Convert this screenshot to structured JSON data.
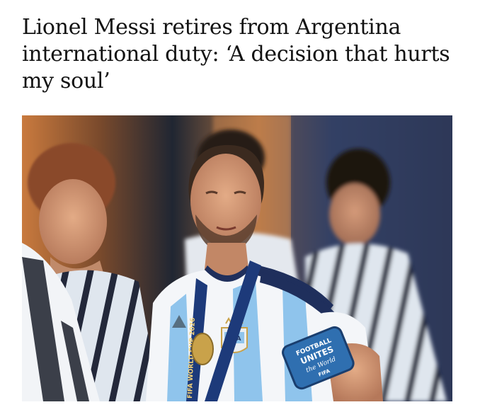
{
  "article": {
    "headline": "Lionel Messi retires from Argentina international duty: ‘A decision that hurts my soul’"
  },
  "photo": {
    "lanyard_text": "FIFA WORLD CUP 2026",
    "patch_text": "AFA",
    "armband_lines": [
      "FOOTBALL",
      "UNITES",
      "the World",
      "FIFA"
    ],
    "colors": {
      "sky_blue": "#8fc4ec",
      "navy": "#1f2f5c",
      "lanyard": "#1d3a7a",
      "gold": "#c9a24a"
    }
  }
}
